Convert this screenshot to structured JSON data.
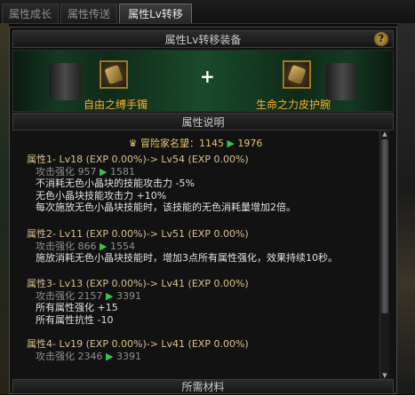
{
  "tabs": [
    {
      "label": "属性成长"
    },
    {
      "label": "属性传送"
    },
    {
      "label": "属性Lv转移"
    }
  ],
  "header": {
    "title": "属性Lv转移装备",
    "help": "?"
  },
  "banner": {
    "plus": "+",
    "left_item": "自由之缚手镯",
    "right_item": "生命之力皮护腕",
    "name_color": "#ffae2a"
  },
  "desc_header": "属性说明",
  "reputation": {
    "label": "冒险家名望：1145",
    "arrow": "▶",
    "value": "1976"
  },
  "attributes": [
    {
      "title": "属性1- Lv18 (EXP 0.00%)-> Lv54 (EXP 0.00%)",
      "stat": "攻击强化 957",
      "arrow": "▶",
      "stat_to": "1581",
      "lines": [
        "不消耗无色小晶块的技能攻击力 -5%",
        "无色小晶块技能攻击力 +10%",
        "每次施放无色小晶块技能时，该技能的无色消耗量增加2倍。"
      ]
    },
    {
      "title": "属性2- Lv11 (EXP 0.00%)-> Lv51 (EXP 0.00%)",
      "stat": "攻击强化 866",
      "arrow": "▶",
      "stat_to": "1554",
      "lines": [
        "施放消耗无色小晶块技能时，增加3点所有属性强化，效果持续10秒。"
      ]
    },
    {
      "title": "属性3- Lv13 (EXP 0.00%)-> Lv41 (EXP 0.00%)",
      "stat": "攻击强化 2157",
      "arrow": "▶",
      "stat_to": "3391",
      "lines": [
        "所有属性强化 +15",
        "所有属性抗性 -10"
      ]
    },
    {
      "title": "属性4- Lv19 (EXP 0.00%)-> Lv41 (EXP 0.00%)",
      "stat": "攻击强化 2346",
      "arrow": "▶",
      "stat_to": "3391",
      "lines": []
    }
  ],
  "materials_header": "所需材料",
  "colors": {
    "accent_gold": "#e8c36a",
    "arrow_green": "#39c24a"
  },
  "icons": {
    "help": "question-icon",
    "reputation": "crown-icon",
    "left": "bracer-icon",
    "right": "gauntlet-icon"
  }
}
